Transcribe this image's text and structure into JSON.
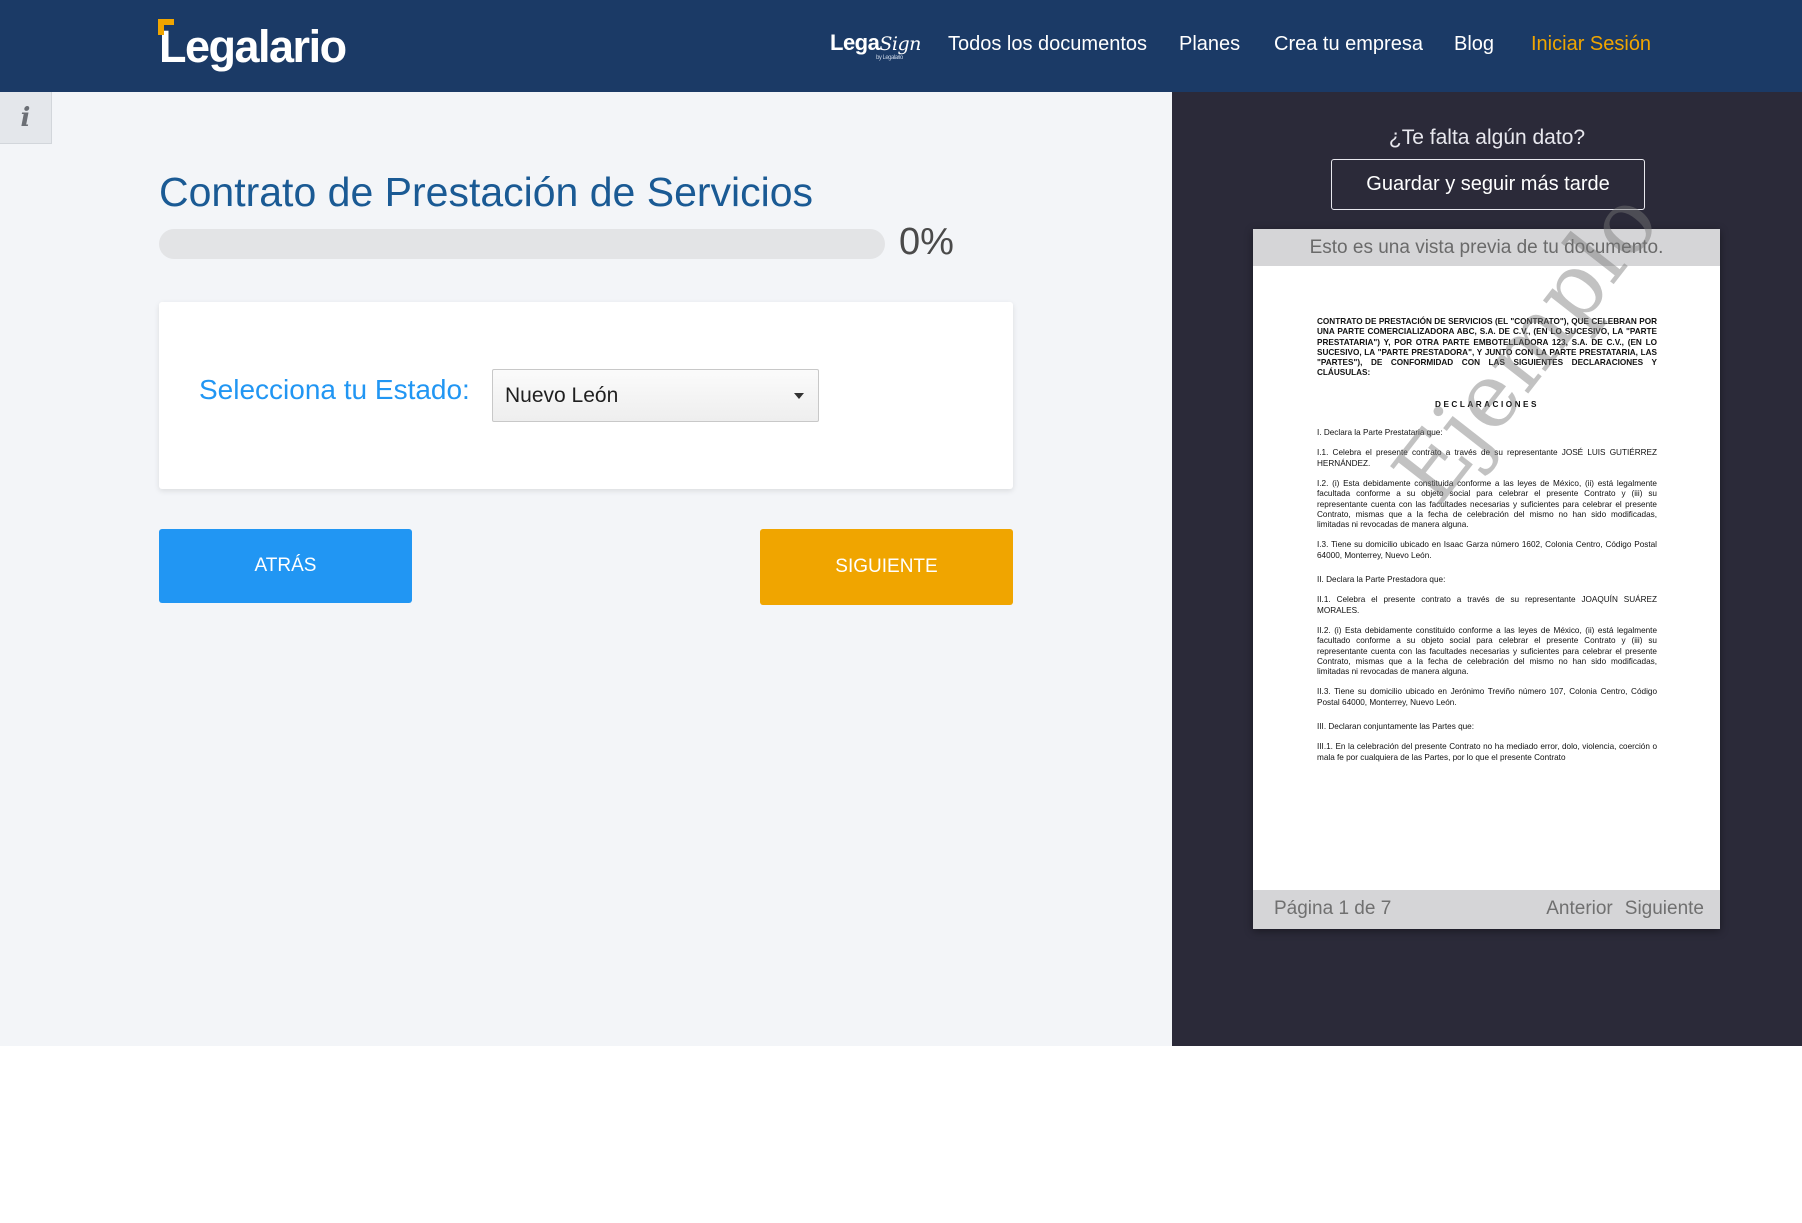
{
  "header": {
    "logo_text": "Legalario",
    "legasign_brand": "Lega",
    "legasign_brand_script": "Sign",
    "legasign_sub": "by Legalario",
    "nav": [
      {
        "label": "Todos los documentos"
      },
      {
        "label": "Planes"
      },
      {
        "label": "Crea tu empresa"
      },
      {
        "label": "Blog"
      },
      {
        "label": "Iniciar Sesión"
      }
    ],
    "colors": {
      "bar": "#1b3a66",
      "login": "#f0a500"
    }
  },
  "main": {
    "info_icon": "i",
    "title": "Contrato de Prestación de Servicios",
    "progress": {
      "value": 0,
      "label": "0%"
    },
    "form": {
      "label": "Selecciona tu Estado:",
      "selected": "Nuevo León"
    },
    "buttons": {
      "back": "ATRÁS",
      "next": "SIGUIENTE"
    }
  },
  "sidebar": {
    "missing_data": "¿Te falta algún dato?",
    "save_button": "Guardar y seguir más tarde",
    "preview": {
      "header": "Esto es una vista previa de tu documento.",
      "watermark": "Ejemplo",
      "page_info": "Página 1 de 7",
      "prev": "Anterior",
      "next": "Siguiente",
      "doc": {
        "intro": "CONTRATO DE PRESTACIÓN DE SERVICIOS (EL \"CONTRATO\"), QUE CELEBRAN POR UNA PARTE COMERCIALIZADORA ABC, S.A. DE C.V., (EN LO SUCESIVO, LA \"PARTE PRESTATARIA\") Y, POR OTRA PARTE EMBOTELLADORA 123, S.A. DE C.V., (EN LO SUCESIVO, LA \"PARTE PRESTADORA\", Y JUNTO CON LA PARTE PRESTATARIA, LAS \"PARTES\"), DE CONFORMIDAD CON LAS SIGUIENTES DECLARACIONES Y CLÁUSULAS:",
        "declaraciones": "DECLARACIONES",
        "s1": "I.        Declara la Parte Prestataria que:",
        "s1_1": "I.1.        Celebra el presente contrato a través de su representante JOSÉ LUIS GUTIÉRREZ HERNÁNDEZ.",
        "s1_2": "I.2.    (i) Esta debidamente constituida conforme a las leyes de México, (ii) está legalmente facultada conforme a su objeto social para celebrar el presente Contrato y (iii) su representante cuenta con las facultades necesarias y suficientes para celebrar el presente Contrato, mismas que a la fecha de celebración del mismo no han sido modificadas, limitadas ni revocadas de manera alguna.",
        "s1_3": "I.3.    Tiene su domicilio ubicado en Isaac Garza número 1602, Colonia Centro, Código Postal 64000, Monterrey, Nuevo León.",
        "s2": "II.       Declara la Parte Prestadora que:",
        "s2_1": "II.1.   Celebra el presente contrato a través de su representante JOAQUÍN SUÁREZ MORALES.",
        "s2_2": "II.2.   (i) Esta debidamente constituido conforme a las leyes de México, (ii) está legalmente facultado conforme a su objeto social para celebrar el presente Contrato y (iii) su representante cuenta con las facultades necesarias y suficientes para celebrar el presente Contrato, mismas que a la fecha de celebración del mismo no han sido modificadas, limitadas ni revocadas de manera alguna.",
        "s2_3": "II.3.   Tiene su domicilio ubicado en Jerónimo Treviño número 107, Colonia Centro, Código Postal 64000, Monterrey, Nuevo León.",
        "s3": "III.      Declaran conjuntamente las Partes que:",
        "s3_1": "III.1. En la celebración del presente Contrato no ha mediado error, dolo, violencia, coerción o mala fe por cualquiera de las Partes, por lo que el presente Contrato"
      }
    }
  }
}
